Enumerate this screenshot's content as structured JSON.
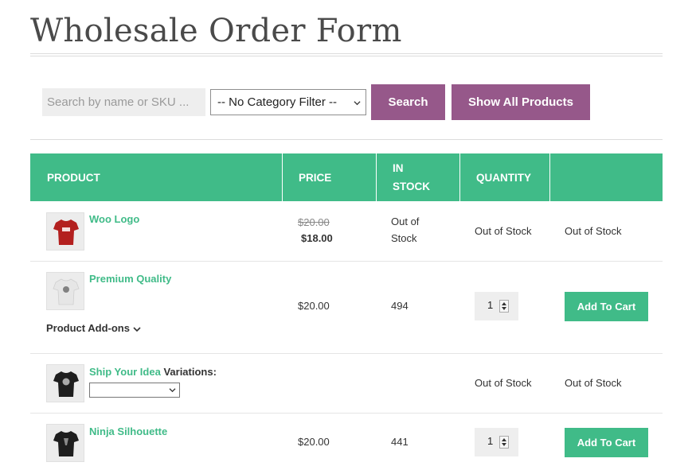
{
  "page": {
    "title": "Wholesale Order Form"
  },
  "toolbar": {
    "search_placeholder": "Search by name or SKU ...",
    "category_selected": "-- No Category Filter --",
    "search_label": "Search",
    "show_all_label": "Show All Products"
  },
  "table": {
    "headers": [
      "PRODUCT",
      "PRICE",
      "IN",
      "STOCK",
      "QUANTITY",
      ""
    ],
    "rows": [
      {
        "name": "Woo Logo",
        "old_price": "$20.00",
        "price": "$18.00",
        "stock_line1": "Out of",
        "stock_line2": "Stock",
        "quantity": "Out of Stock",
        "action": "Out of Stock",
        "shirt_color": "#b3201f"
      },
      {
        "name": "Premium Quality",
        "addons_label": "Product Add-ons",
        "price": "$20.00",
        "stock": "494",
        "qty": "1",
        "button_label": "Add To Cart",
        "shirt_color": "#e6e6e6"
      },
      {
        "name": "Ship Your Idea",
        "variations_label": "Variations:",
        "quantity": "Out of Stock",
        "action": "Out of Stock",
        "shirt_color": "#1e1e1e"
      },
      {
        "name": "Ninja Silhouette",
        "price": "$20.00",
        "stock": "441",
        "qty": "1",
        "button_label": "Add To Cart",
        "shirt_color": "#1e1e1e"
      }
    ]
  },
  "colors": {
    "accent_green": "#40bb88",
    "button_purple": "#96588a"
  },
  "icons": {
    "dropdown": "chevron-down-icon",
    "product": "tshirt-icon"
  }
}
